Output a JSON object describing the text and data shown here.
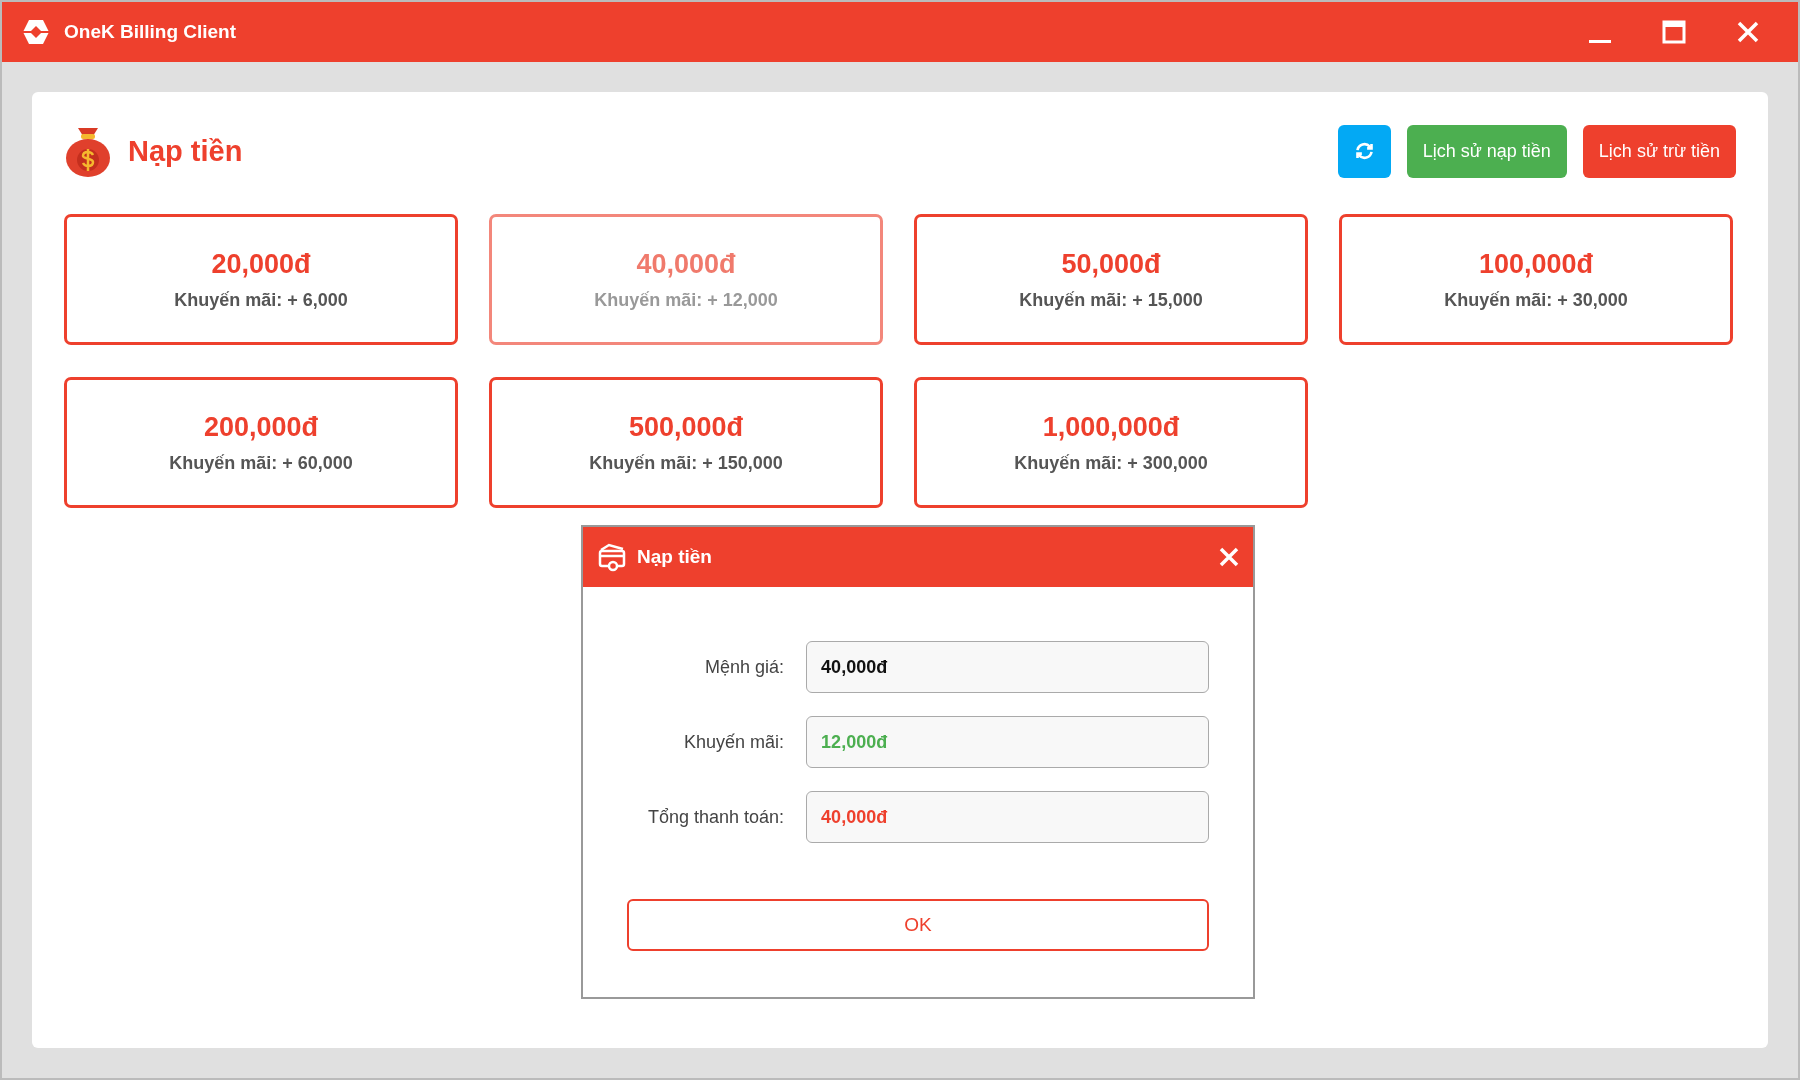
{
  "window": {
    "title": "OneK Billing Client"
  },
  "page": {
    "title": "Nạp tiền",
    "buttons": [
      {
        "kind": "refresh"
      },
      {
        "kind": "green",
        "label": "Lịch sử nạp tiền"
      },
      {
        "kind": "red",
        "label": "Lịch sử trừ tiền"
      }
    ]
  },
  "packages": [
    {
      "amount": "20,000đ",
      "promo": "Khuyến mãi: + 6,000",
      "selected": false
    },
    {
      "amount": "40,000đ",
      "promo": "Khuyến mãi: + 12,000",
      "selected": true
    },
    {
      "amount": "50,000đ",
      "promo": "Khuyến mãi: + 15,000",
      "selected": false
    },
    {
      "amount": "100,000đ",
      "promo": "Khuyến mãi: + 30,000",
      "selected": false
    },
    {
      "amount": "200,000đ",
      "promo": "Khuyến mãi: + 60,000",
      "selected": false
    },
    {
      "amount": "500,000đ",
      "promo": "Khuyến mãi: + 150,000",
      "selected": false
    },
    {
      "amount": "1,000,000đ",
      "promo": "Khuyến mãi: + 300,000",
      "selected": false
    }
  ],
  "dialog": {
    "title": "Nạp tiền",
    "fields": [
      {
        "label": "Mệnh giá:",
        "value": "40,000đ",
        "color": "#111111"
      },
      {
        "label": "Khuyến mãi:",
        "value": "12,000đ",
        "color": "#4caf50"
      },
      {
        "label": "Tổng thanh toán:",
        "value": "40,000đ",
        "color": "#ee402d"
      }
    ],
    "ok": "OK"
  }
}
